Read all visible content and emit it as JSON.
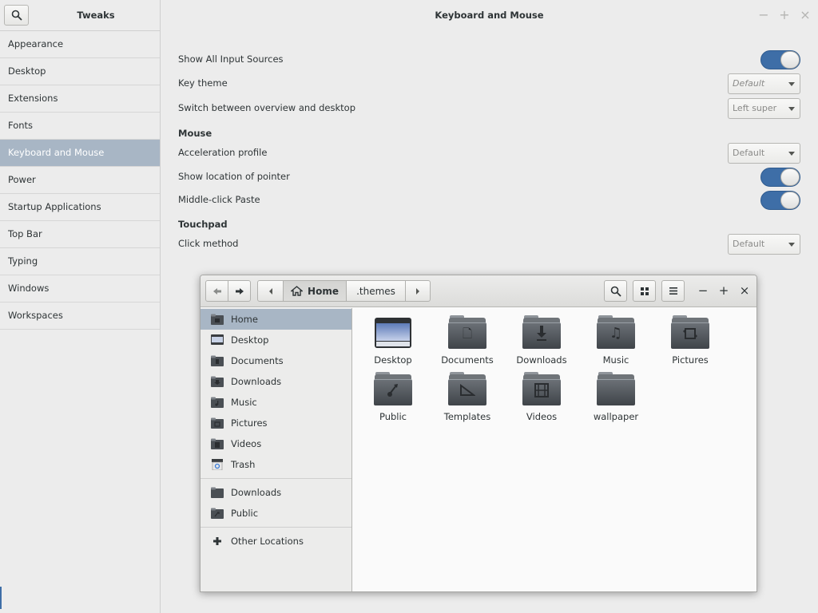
{
  "tweaks": {
    "app_title": "Tweaks",
    "page_title": "Keyboard and Mouse",
    "sidebar": [
      {
        "label": "Appearance"
      },
      {
        "label": "Desktop"
      },
      {
        "label": "Extensions"
      },
      {
        "label": "Fonts"
      },
      {
        "label": "Keyboard and Mouse",
        "active": true
      },
      {
        "label": "Power"
      },
      {
        "label": "Startup Applications"
      },
      {
        "label": "Top Bar"
      },
      {
        "label": "Typing"
      },
      {
        "label": "Windows"
      },
      {
        "label": "Workspaces"
      }
    ],
    "settings": {
      "show_all_input_sources": {
        "label": "Show All Input Sources",
        "on": true
      },
      "key_theme": {
        "label": "Key theme",
        "value": "Default"
      },
      "switch_overview": {
        "label": "Switch between overview and desktop",
        "value": "Left super"
      },
      "mouse_section": "Mouse",
      "acceleration_profile": {
        "label": "Acceleration profile",
        "value": "Default"
      },
      "show_location_pointer": {
        "label": "Show location of pointer",
        "on": true
      },
      "middle_click_paste": {
        "label": "Middle-click Paste",
        "on": true
      },
      "touchpad_section": "Touchpad",
      "click_method": {
        "label": "Click method",
        "value": "Default"
      }
    },
    "accent_color": "#3e6ea7",
    "selected_color": "#a8b6c5"
  },
  "files": {
    "path": {
      "home": "Home",
      "current": ".themes"
    },
    "sidebar": [
      {
        "label": "Home",
        "icon": "home-folder-icon",
        "active": true
      },
      {
        "label": "Desktop",
        "icon": "desktop-icon"
      },
      {
        "label": "Documents",
        "icon": "documents-folder-icon"
      },
      {
        "label": "Downloads",
        "icon": "downloads-folder-icon"
      },
      {
        "label": "Music",
        "icon": "music-folder-icon"
      },
      {
        "label": "Pictures",
        "icon": "pictures-folder-icon"
      },
      {
        "label": "Videos",
        "icon": "videos-folder-icon"
      },
      {
        "label": "Trash",
        "icon": "trash-icon"
      }
    ],
    "bookmarks": [
      {
        "label": "Downloads",
        "icon": "downloads-folder-icon"
      },
      {
        "label": "Public",
        "icon": "public-folder-icon"
      }
    ],
    "other_locations": "Other Locations",
    "items": [
      {
        "name": "Desktop",
        "icon": "desktop-icon"
      },
      {
        "name": "Documents",
        "icon": "documents-folder-icon"
      },
      {
        "name": "Downloads",
        "icon": "downloads-folder-icon"
      },
      {
        "name": "Music",
        "icon": "music-folder-icon"
      },
      {
        "name": "Pictures",
        "icon": "pictures-folder-icon"
      },
      {
        "name": "Public",
        "icon": "public-folder-icon"
      },
      {
        "name": "Templates",
        "icon": "templates-folder-icon"
      },
      {
        "name": "Videos",
        "icon": "videos-folder-icon"
      },
      {
        "name": "wallpaper",
        "icon": "folder-icon"
      }
    ]
  }
}
